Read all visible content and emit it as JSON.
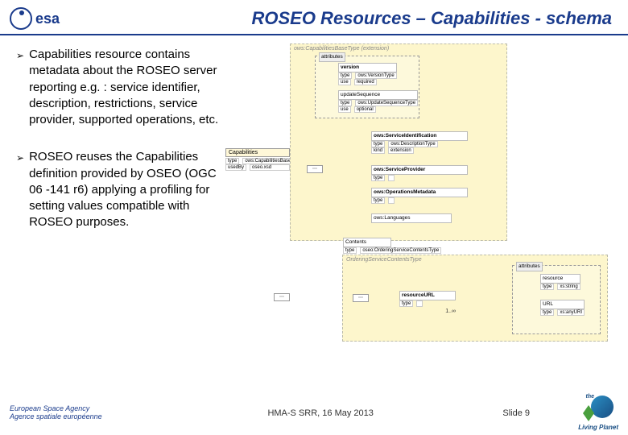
{
  "header": {
    "logo_text": "esa",
    "title": "ROSEO Resources – Capabilities - schema"
  },
  "bullets": [
    "Capabilities resource contains metadata about the ROSEO server reporting e.g. : service identifier, description, restrictions, service provider, supported operations, etc.",
    "ROSEO reuses the Capabilities definition provided by OSEO (OGC 06 -141 r6) applying a profiling for setting values compatible with ROSEO purposes."
  ],
  "schema": {
    "base_label": "ows:CapabilitiesBaseType (extension)",
    "attributes_label": "attributes",
    "version_label": "version",
    "version_type": "ows:VersionType",
    "version_use": "required",
    "update_label": "updateSequence",
    "update_type": "ows:UpdateSequenceType",
    "update_use": "optional",
    "cap_label": "Capabilities",
    "cap_type_a": "type",
    "cap_type_b": "ows:CapabilitiesBaseType",
    "cap_used_a": "usedBy",
    "cap_used_b": "oseo.xsd",
    "svc_id": "ows:ServiceIdentification",
    "svc_id_type": "ows:DescriptionType",
    "svc_id_ext": "extension",
    "svc_provider": "ows:ServiceProvider",
    "ops_meta": "ows:OperationsMetadata",
    "ops_type": "type",
    "lang_label": "ows:Languages",
    "contents_box_label": "OrderingServiceContentsType",
    "contents_label": "Contents",
    "contents_type": "oseo:OrderingServiceContentsType",
    "attr2": "attributes",
    "resource": "resource",
    "resource_url": "resourceURL",
    "resource_type": "type",
    "url": "URL",
    "xs_string": "xs:string",
    "xs_anyuri": "xs:anyURI",
    "one_inf": "1..∞"
  },
  "footer": {
    "agency_en": "European Space Agency",
    "agency_fr": "Agence spatiale européenne",
    "center": "HMA-S SRR, 16 May 2013",
    "slide": "Slide 9",
    "planet": "Living Planet",
    "planet_the": "the"
  }
}
